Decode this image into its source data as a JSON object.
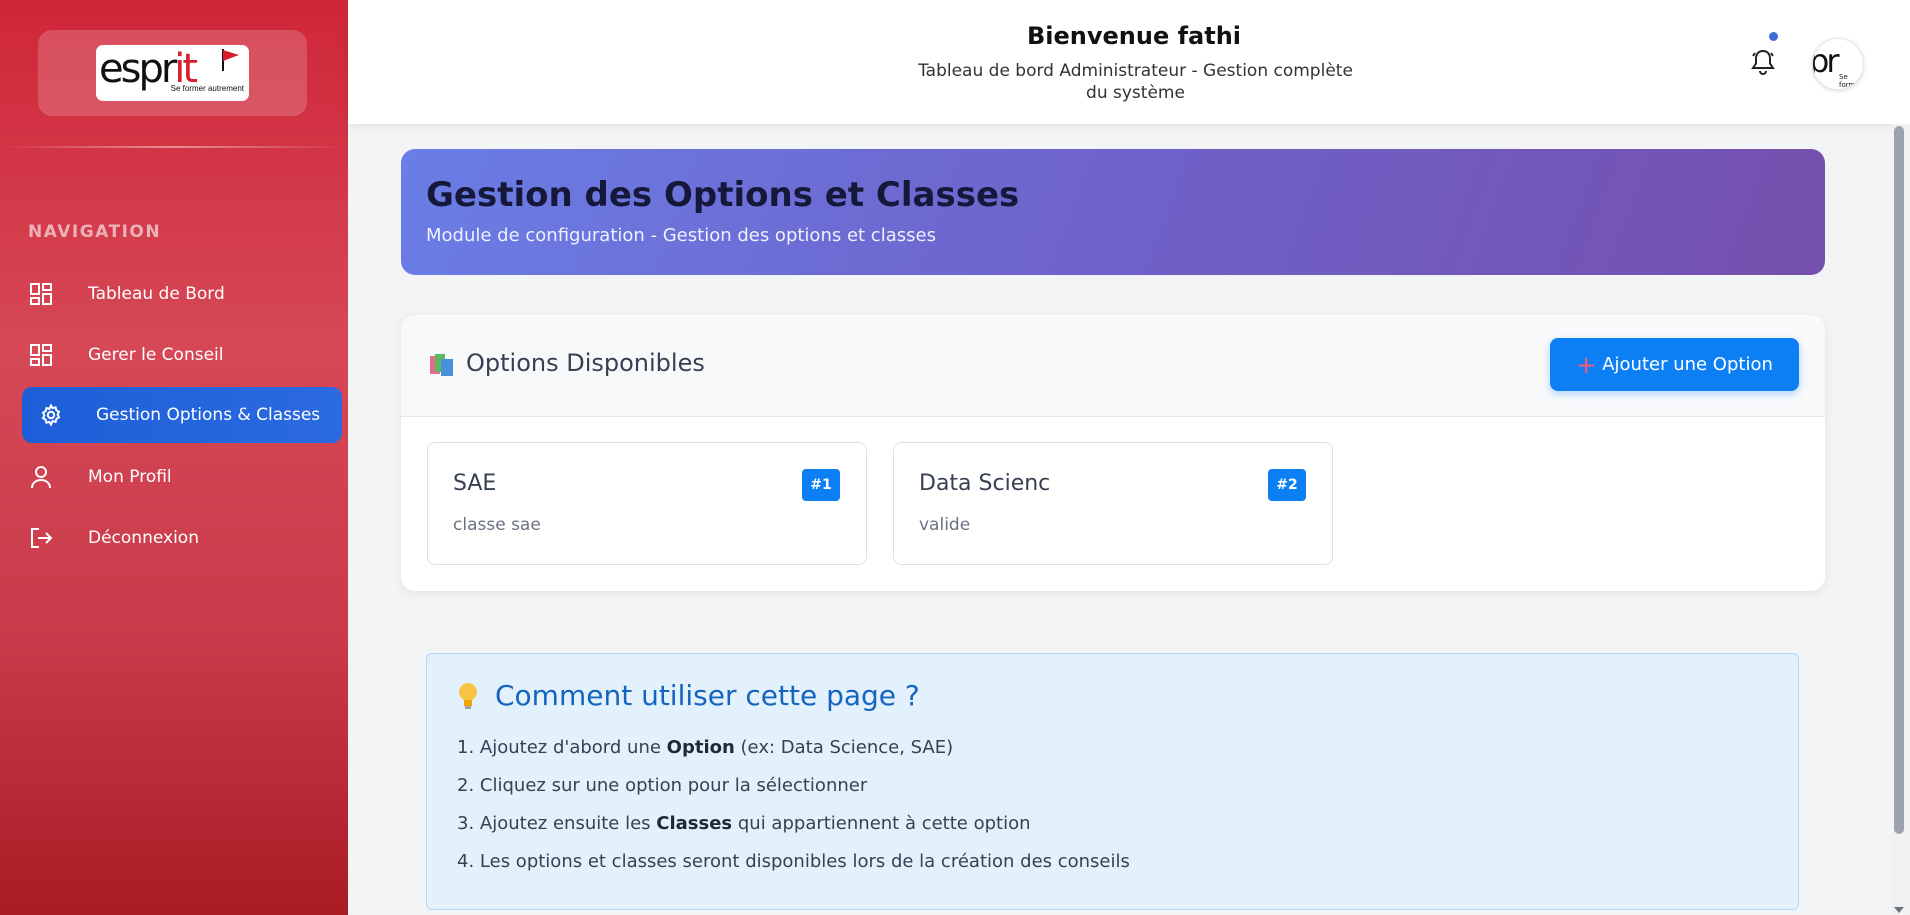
{
  "brand": {
    "logo_word_a": "espr",
    "logo_word_b": "it",
    "tagline": "Se former autrement"
  },
  "sidebar": {
    "heading": "NAVIGATION",
    "items": [
      {
        "label": "Tableau de Bord",
        "icon": "dashboard-icon"
      },
      {
        "label": "Gerer le Conseil",
        "icon": "dashboard-icon"
      },
      {
        "label": "Gestion Options & Classes",
        "icon": "gear-icon",
        "active": true
      },
      {
        "label": "Mon Profil",
        "icon": "user-icon"
      },
      {
        "label": "Déconnexion",
        "icon": "logout-icon"
      }
    ]
  },
  "header": {
    "title": "Bienvenue fathi",
    "subtitle": "Tableau de bord Administrateur - Gestion complète du système",
    "avatar_word": "pr",
    "avatar_tag": "Se form"
  },
  "banner": {
    "title": "Gestion des Options et Classes",
    "subtitle": "Module de configuration - Gestion des options et classes"
  },
  "options": {
    "title": "Options Disponibles",
    "add_label": "Ajouter une Option",
    "items": [
      {
        "name": "SAE",
        "description": "classe sae",
        "badge": "#1"
      },
      {
        "name": "Data Scienc",
        "description": "valide",
        "badge": "#2"
      }
    ]
  },
  "help": {
    "title": "Comment utiliser cette page ?",
    "steps": [
      {
        "num": "1.",
        "pre": "Ajoutez d'abord une ",
        "bold": "Option",
        "post": " (ex: Data Science, SAE)"
      },
      {
        "num": "2.",
        "pre": "Cliquez sur une option pour la sélectionner",
        "bold": "",
        "post": ""
      },
      {
        "num": "3.",
        "pre": "Ajoutez ensuite les ",
        "bold": "Classes",
        "post": " qui appartiennent à cette option"
      },
      {
        "num": "4.",
        "pre": "Les options et classes seront disponibles lors de la création des conseils",
        "bold": "",
        "post": ""
      }
    ]
  },
  "colors": {
    "sidebar": "#cf2638",
    "active": "#1d5ed8",
    "primary": "#0d7ff5",
    "banner_start": "#6a7ee6",
    "banner_end": "#7550ad"
  }
}
